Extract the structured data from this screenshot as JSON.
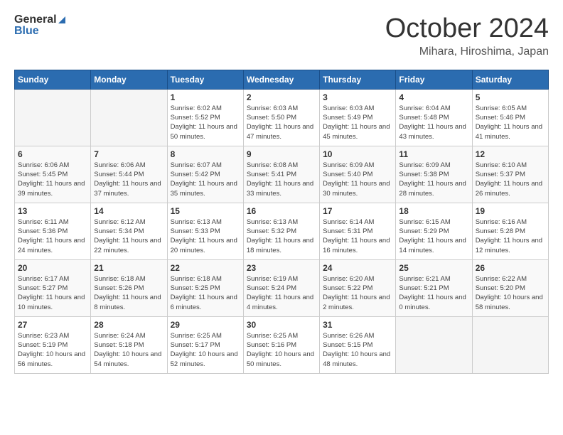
{
  "logo": {
    "text_general": "General",
    "text_blue": "Blue"
  },
  "title": "October 2024",
  "location": "Mihara, Hiroshima, Japan",
  "days_of_week": [
    "Sunday",
    "Monday",
    "Tuesday",
    "Wednesday",
    "Thursday",
    "Friday",
    "Saturday"
  ],
  "weeks": [
    [
      {
        "day": "",
        "info": ""
      },
      {
        "day": "",
        "info": ""
      },
      {
        "day": "1",
        "info": "Sunrise: 6:02 AM\nSunset: 5:52 PM\nDaylight: 11 hours and 50 minutes."
      },
      {
        "day": "2",
        "info": "Sunrise: 6:03 AM\nSunset: 5:50 PM\nDaylight: 11 hours and 47 minutes."
      },
      {
        "day": "3",
        "info": "Sunrise: 6:03 AM\nSunset: 5:49 PM\nDaylight: 11 hours and 45 minutes."
      },
      {
        "day": "4",
        "info": "Sunrise: 6:04 AM\nSunset: 5:48 PM\nDaylight: 11 hours and 43 minutes."
      },
      {
        "day": "5",
        "info": "Sunrise: 6:05 AM\nSunset: 5:46 PM\nDaylight: 11 hours and 41 minutes."
      }
    ],
    [
      {
        "day": "6",
        "info": "Sunrise: 6:06 AM\nSunset: 5:45 PM\nDaylight: 11 hours and 39 minutes."
      },
      {
        "day": "7",
        "info": "Sunrise: 6:06 AM\nSunset: 5:44 PM\nDaylight: 11 hours and 37 minutes."
      },
      {
        "day": "8",
        "info": "Sunrise: 6:07 AM\nSunset: 5:42 PM\nDaylight: 11 hours and 35 minutes."
      },
      {
        "day": "9",
        "info": "Sunrise: 6:08 AM\nSunset: 5:41 PM\nDaylight: 11 hours and 33 minutes."
      },
      {
        "day": "10",
        "info": "Sunrise: 6:09 AM\nSunset: 5:40 PM\nDaylight: 11 hours and 30 minutes."
      },
      {
        "day": "11",
        "info": "Sunrise: 6:09 AM\nSunset: 5:38 PM\nDaylight: 11 hours and 28 minutes."
      },
      {
        "day": "12",
        "info": "Sunrise: 6:10 AM\nSunset: 5:37 PM\nDaylight: 11 hours and 26 minutes."
      }
    ],
    [
      {
        "day": "13",
        "info": "Sunrise: 6:11 AM\nSunset: 5:36 PM\nDaylight: 11 hours and 24 minutes."
      },
      {
        "day": "14",
        "info": "Sunrise: 6:12 AM\nSunset: 5:34 PM\nDaylight: 11 hours and 22 minutes."
      },
      {
        "day": "15",
        "info": "Sunrise: 6:13 AM\nSunset: 5:33 PM\nDaylight: 11 hours and 20 minutes."
      },
      {
        "day": "16",
        "info": "Sunrise: 6:13 AM\nSunset: 5:32 PM\nDaylight: 11 hours and 18 minutes."
      },
      {
        "day": "17",
        "info": "Sunrise: 6:14 AM\nSunset: 5:31 PM\nDaylight: 11 hours and 16 minutes."
      },
      {
        "day": "18",
        "info": "Sunrise: 6:15 AM\nSunset: 5:29 PM\nDaylight: 11 hours and 14 minutes."
      },
      {
        "day": "19",
        "info": "Sunrise: 6:16 AM\nSunset: 5:28 PM\nDaylight: 11 hours and 12 minutes."
      }
    ],
    [
      {
        "day": "20",
        "info": "Sunrise: 6:17 AM\nSunset: 5:27 PM\nDaylight: 11 hours and 10 minutes."
      },
      {
        "day": "21",
        "info": "Sunrise: 6:18 AM\nSunset: 5:26 PM\nDaylight: 11 hours and 8 minutes."
      },
      {
        "day": "22",
        "info": "Sunrise: 6:18 AM\nSunset: 5:25 PM\nDaylight: 11 hours and 6 minutes."
      },
      {
        "day": "23",
        "info": "Sunrise: 6:19 AM\nSunset: 5:24 PM\nDaylight: 11 hours and 4 minutes."
      },
      {
        "day": "24",
        "info": "Sunrise: 6:20 AM\nSunset: 5:22 PM\nDaylight: 11 hours and 2 minutes."
      },
      {
        "day": "25",
        "info": "Sunrise: 6:21 AM\nSunset: 5:21 PM\nDaylight: 11 hours and 0 minutes."
      },
      {
        "day": "26",
        "info": "Sunrise: 6:22 AM\nSunset: 5:20 PM\nDaylight: 10 hours and 58 minutes."
      }
    ],
    [
      {
        "day": "27",
        "info": "Sunrise: 6:23 AM\nSunset: 5:19 PM\nDaylight: 10 hours and 56 minutes."
      },
      {
        "day": "28",
        "info": "Sunrise: 6:24 AM\nSunset: 5:18 PM\nDaylight: 10 hours and 54 minutes."
      },
      {
        "day": "29",
        "info": "Sunrise: 6:25 AM\nSunset: 5:17 PM\nDaylight: 10 hours and 52 minutes."
      },
      {
        "day": "30",
        "info": "Sunrise: 6:25 AM\nSunset: 5:16 PM\nDaylight: 10 hours and 50 minutes."
      },
      {
        "day": "31",
        "info": "Sunrise: 6:26 AM\nSunset: 5:15 PM\nDaylight: 10 hours and 48 minutes."
      },
      {
        "day": "",
        "info": ""
      },
      {
        "day": "",
        "info": ""
      }
    ]
  ],
  "accent_color": "#2b6cb0"
}
